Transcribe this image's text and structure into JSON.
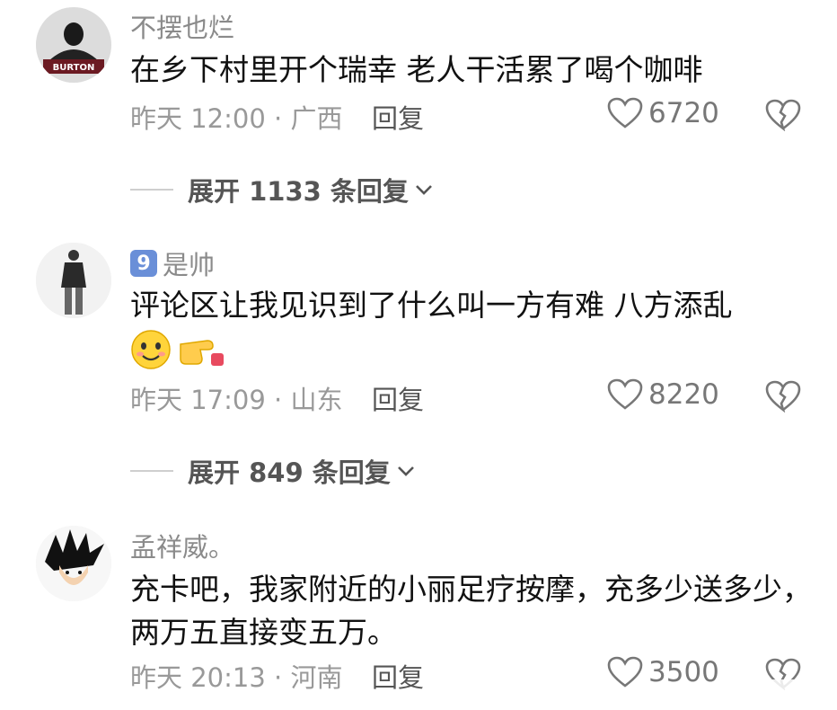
{
  "comments": [
    {
      "username": "不摆也烂",
      "text": "在乡下村里开个瑞幸 老人干活累了喝个咖啡",
      "meta": "昨天 12:00 · 广西",
      "reply_label": "回复",
      "likes": "6720",
      "expand_label": "展开 1133 条回复",
      "avatar_caption": "BURTON"
    },
    {
      "level": "9",
      "username": "是帅",
      "text": "评论区让我见识到了什么叫一方有难 八方添乱",
      "emoji": [
        "smiling-face-emoji",
        "pointing-right-emoji"
      ],
      "meta": "昨天 17:09 · 山东",
      "reply_label": "回复",
      "likes": "8220",
      "expand_label": "展开 849 条回复"
    },
    {
      "username": "孟祥威。",
      "text": "充卡吧，我家附近的小丽足疗按摩，充多少送多少，两万五直接变五万。",
      "meta": "昨天 20:13 · 河南",
      "reply_label": "回复",
      "likes": "3500"
    }
  ],
  "colors": {
    "username": "#8a8a8a",
    "text": "#111111",
    "meta": "#999999",
    "badge": "#6a8fd8"
  }
}
